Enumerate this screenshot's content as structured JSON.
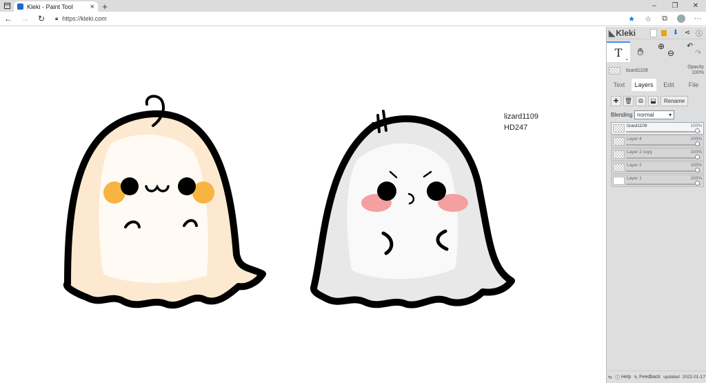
{
  "browser": {
    "tab_title": "Kleki - Paint Tool",
    "url": "https://kleki.com"
  },
  "canvas": {
    "text_lines": [
      "lizard1109",
      "HD247"
    ]
  },
  "panel": {
    "brand": "Kleki",
    "active_layer": {
      "name": "lizard1109",
      "opacity_label": "Opacity",
      "opacity_value": "100%"
    },
    "tabs": [
      {
        "label": "Text",
        "active": false
      },
      {
        "label": "Layers",
        "active": true
      },
      {
        "label": "Edit",
        "active": false
      },
      {
        "label": "File",
        "active": false
      }
    ],
    "rename_label": "Rename",
    "blending_label": "Blending",
    "blending_value": "normal",
    "layers": [
      {
        "name": "lizard1109",
        "opacity": "100%",
        "selected": true
      },
      {
        "name": "Layer 4",
        "opacity": "100%",
        "selected": false
      },
      {
        "name": "Layer 2 copy",
        "opacity": "100%",
        "selected": false
      },
      {
        "name": "Layer 2",
        "opacity": "100%",
        "selected": false
      },
      {
        "name": "Layer 1",
        "opacity": "100%",
        "selected": false
      }
    ],
    "footer": {
      "help": "Help",
      "feedback": "Feedback",
      "updated_label": "updated",
      "updated_date": "2022-01-17"
    }
  },
  "colors": {
    "accent": "#1a73e8",
    "ghost_left_tint": "#fde9cf",
    "ghost_right_tint": "#e6e6e6",
    "cheek_left": "#f7b441",
    "cheek_right": "#f4a0a0"
  }
}
